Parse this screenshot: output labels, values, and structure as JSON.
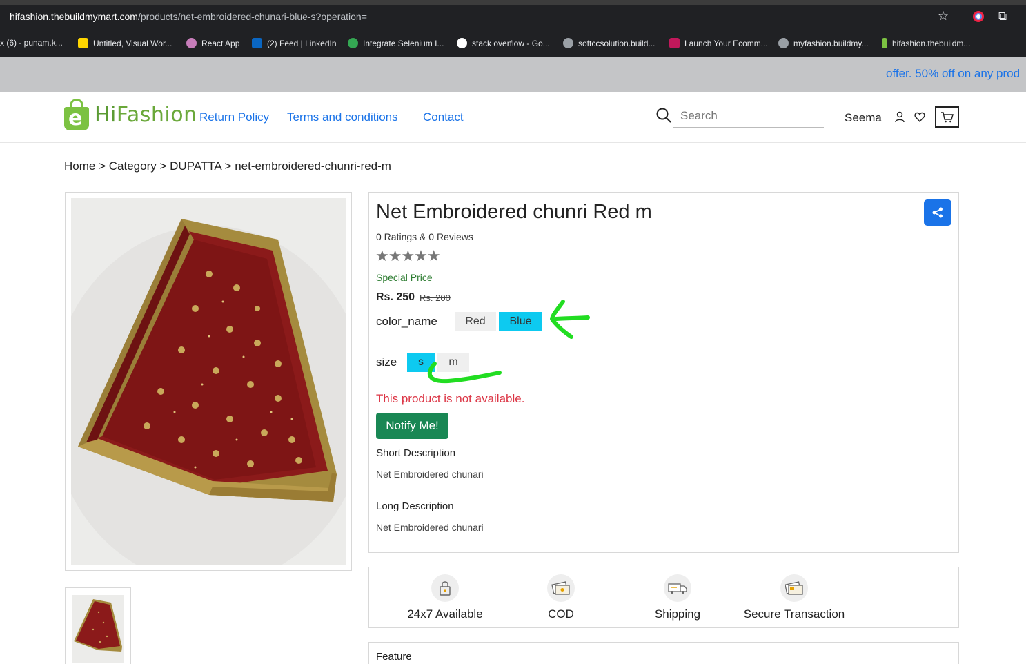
{
  "browser": {
    "url_host": "hifashion.thebuildmymart.com",
    "url_path": "/products/net-embroidered-chunari-blue-s?operation=",
    "bookmarks": [
      {
        "label": "x (6) - punam.k...",
        "color": "#ffffff"
      },
      {
        "label": "Untitled, Visual Wor...",
        "color": "#ffd600"
      },
      {
        "label": "React App",
        "color": "#ffffff"
      },
      {
        "label": "(2) Feed | LinkedIn",
        "color": "#0a66c2"
      },
      {
        "label": "Integrate Selenium I...",
        "color": "#34a853"
      },
      {
        "label": "stack overflow - Go...",
        "color": "#ffffff"
      },
      {
        "label": "softccsolution.build...",
        "color": "#9aa0a6"
      },
      {
        "label": "Launch Your Ecomm...",
        "color": "#c2185b"
      },
      {
        "label": "myfashion.buildmy...",
        "color": "#9aa0a6"
      },
      {
        "label": "hifashion.thebuildm...",
        "color": "#7cc242"
      }
    ]
  },
  "offer_banner": "offer. 50% off on any prod",
  "header": {
    "logo_hi": "Hi",
    "logo_rest": "Fashion",
    "logo_letter": "e",
    "nav": [
      "Return Policy",
      "Terms and conditions",
      "Contact"
    ],
    "search_placeholder": "Search",
    "user_name": "Seema"
  },
  "breadcrumb": {
    "home": "Home",
    "category": "Category",
    "sub": "DUPATTA",
    "current": "net-embroidered-chunri-red-m",
    "sep": ">"
  },
  "product": {
    "title": "Net Embroidered chunri Red m",
    "ratings_text": "0 Ratings & 0 Reviews",
    "stars": "★★★★★",
    "special_price_label": "Special Price",
    "price": "Rs. 250",
    "old_price": "Rs. 200",
    "color_label": "color_name",
    "colors": [
      {
        "label": "Red",
        "selected": false
      },
      {
        "label": "Blue",
        "selected": true
      }
    ],
    "size_label": "size",
    "sizes": [
      {
        "label": "s",
        "selected": true
      },
      {
        "label": "m",
        "selected": false
      }
    ],
    "availability": "This product is not available.",
    "notify_label": "Notify Me!",
    "short_desc_title": "Short Description",
    "short_desc": "Net Embroidered chunari",
    "long_desc_title": "Long Description",
    "long_desc": "Net Embroidered chunari"
  },
  "features": [
    {
      "label": "24x7 Available",
      "icon": "lock-icon"
    },
    {
      "label": "COD",
      "icon": "cash-icon"
    },
    {
      "label": "Shipping",
      "icon": "truck-icon"
    },
    {
      "label": "Secure Transaction",
      "icon": "card-icon"
    }
  ],
  "feature_section_title": "Feature",
  "colors": {
    "accent": "#1a73e8",
    "selected_option": "#0dcaf0",
    "notify": "#198754",
    "error": "#dc3545",
    "annotation": "#22dd22",
    "dupatta": "#8b1a1a"
  }
}
